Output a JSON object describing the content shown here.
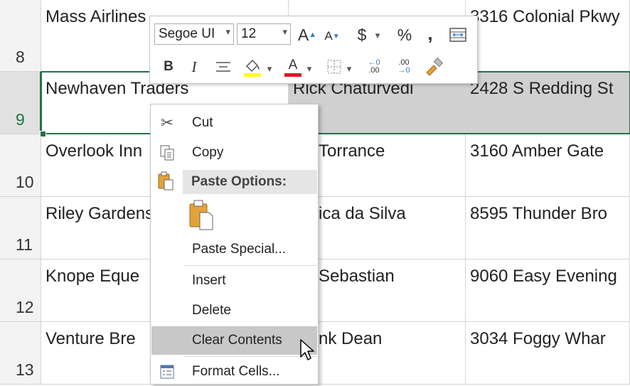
{
  "rows": [
    {
      "num": "8",
      "c1": "Mass Airlines",
      "c2": "",
      "c3": "3316 Colonial Pkwy"
    },
    {
      "num": "9",
      "c1": "Newhaven Traders",
      "c2": "Rick Chaturvedi",
      "c3": "2428 S Redding St"
    },
    {
      "num": "10",
      "c1": "Overlook Inn",
      "c2": "Torrance",
      "c3": "3160 Amber Gate"
    },
    {
      "num": "11",
      "c1": "Riley Gardens",
      "c2": "ica da Silva",
      "c3": "8595 Thunder Bro"
    },
    {
      "num": "12",
      "c1": "Knope Eque",
      "c2": "Sebastian",
      "c3": "9060 Easy Evening"
    },
    {
      "num": "13",
      "c1": "Venture Bre",
      "c2": "nk Dean",
      "c3": "3034 Foggy Whar"
    }
  ],
  "mini_toolbar": {
    "font_name": "Segoe UI",
    "font_size": "12",
    "grow_font": "A",
    "shrink_font": "A",
    "currency": "$",
    "percent": "%",
    "comma": ",",
    "bold": "B",
    "italic": "I",
    "font_color_letter": "A",
    "dec_increase": ".00",
    "dec_decrease": ".00",
    "fill_color": "#ffff00",
    "font_color": "#e81123"
  },
  "context_menu": {
    "cut": "Cut",
    "copy": "Copy",
    "paste_options": "Paste Options:",
    "paste_special": "Paste Special...",
    "insert": "Insert",
    "delete": "Delete",
    "clear_contents": "Clear Contents",
    "format_cells": "Format Cells..."
  },
  "colors": {
    "selection": "#217346",
    "highlight": "#d0d0d0",
    "menu_hover": "#c8c8c8"
  }
}
